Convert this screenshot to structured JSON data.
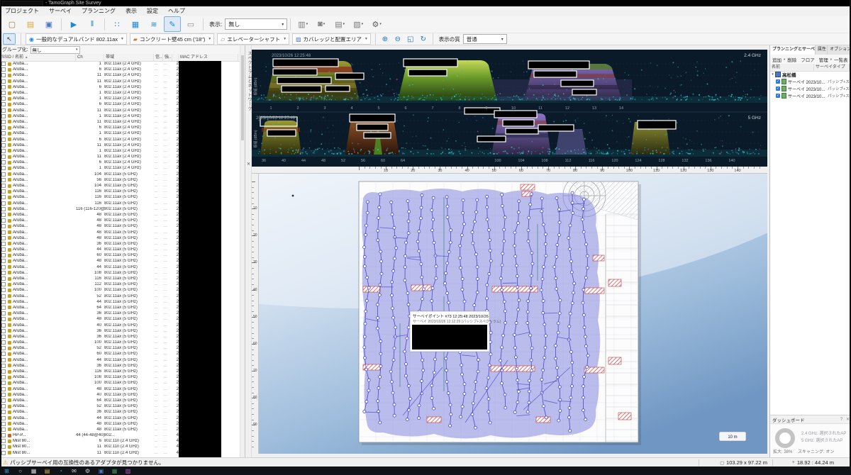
{
  "ui": {
    "dropdown_glyph": "▾",
    "sort_glyph": "▲"
  },
  "titlebar": {
    "title": "- TamoGraph Site Survey"
  },
  "menubar": {
    "items": [
      "プロジェクト",
      "サーベイ",
      "プランニング",
      "表示",
      "設定",
      "ヘルプ"
    ]
  },
  "toolbar1": {
    "buttons": [
      {
        "name": "new-project-icon",
        "glyph": "▢",
        "color": "#9a7a3a"
      },
      {
        "name": "open-project-icon",
        "glyph": "▤",
        "color": "#d8a838"
      },
      {
        "name": "save-project-icon",
        "glyph": "▣",
        "color": "#4a78c0"
      },
      {
        "sep": true
      },
      {
        "name": "start-survey-icon",
        "glyph": "▶",
        "color": "#1e88d0"
      },
      {
        "name": "pause-survey-icon",
        "glyph": "‖",
        "color": "#1e88d0"
      },
      {
        "sep": true
      },
      {
        "name": "survey-point-mode-icon",
        "glyph": "∷",
        "color": "#1e88d0"
      },
      {
        "name": "survey-grid-mode-icon",
        "glyph": "▦",
        "color": "#1e88d0"
      },
      {
        "name": "survey-path-mode-icon",
        "glyph": "≋",
        "color": "#1e88d0"
      },
      {
        "name": "draw-mode-icon",
        "glyph": "✎",
        "color": "#1e88d0",
        "selected": true
      },
      {
        "name": "measure-icon",
        "glyph": "▭",
        "color": "#8a8a8a"
      },
      {
        "sep": true
      }
    ],
    "view_label": "表示:",
    "overlay_value": "無し",
    "buttons2": [
      {
        "name": "link-floors-icon",
        "glyph": "▥",
        "color": "#7a7a7a"
      },
      {
        "name": "snapshot-icon",
        "glyph": "◙",
        "color": "#7a7a7a"
      },
      {
        "name": "report-icon",
        "glyph": "▤",
        "color": "#7a7a7a"
      },
      {
        "name": "export-image-icon",
        "glyph": "▧",
        "color": "#7a7a7a"
      },
      {
        "name": "settings-icon",
        "glyph": "⚙",
        "color": "#5a5a5a"
      }
    ]
  },
  "toolbar2": {
    "cursor_glyph": "↖",
    "items": [
      {
        "name": "ap-model-select",
        "glyph": "◉",
        "glyph_color": "#1e88d0",
        "label": "一般的なデュアルバンド 802.11ax"
      },
      {
        "name": "wall-type-select",
        "glyph": "▰",
        "glyph_color": "#c87830",
        "label": "コンクリート壁45 cm ('18\")"
      },
      {
        "name": "obstruction-select",
        "glyph": "▱",
        "glyph_color": "#8a8a8a",
        "label": "エレベーターシャフト"
      },
      {
        "name": "area-select",
        "glyph": "▨",
        "glyph_color": "#4a78c0",
        "label": "カバレッジと配置エリア"
      }
    ],
    "zoom_icons": [
      {
        "name": "zoom-in-icon",
        "glyph": "⊕"
      },
      {
        "name": "zoom-out-icon",
        "glyph": "⊖"
      },
      {
        "name": "fit-page-icon",
        "glyph": "◱"
      },
      {
        "name": "refresh-icon",
        "glyph": "↻"
      }
    ],
    "quality_label": "表示の質",
    "quality_value": "普通"
  },
  "left_panel": {
    "group_label": "グループ化:",
    "group_value": "無し",
    "columns": [
      "SSID / 名前",
      "Ch",
      "帯域",
      "信...",
      "強...",
      "",
      "MAC アドレス"
    ],
    "default_name": "Aruba...",
    "band_24": "802.11ax (2.4 GHz)",
    "band_5": "802.11ax (5 GHz)",
    "dots": "…",
    "num_default": "2",
    "channels_24": [
      1,
      6,
      11,
      11,
      6,
      1,
      1,
      6,
      11,
      1,
      11,
      6,
      1,
      6,
      11,
      1,
      11,
      6,
      1
    ],
    "channels_5": [
      104,
      56,
      104,
      116,
      116,
      116,
      "116 (116-120@80)",
      48,
      48,
      48,
      48,
      48,
      36,
      44,
      60,
      48,
      44,
      108,
      116,
      112,
      100,
      52,
      44,
      64,
      36,
      48,
      40,
      36,
      36,
      100,
      52,
      60,
      44,
      36,
      116,
      108,
      100,
      48,
      40,
      64,
      52,
      36,
      44,
      48,
      48
    ],
    "special_rows": [
      {
        "name": "HP-P...",
        "ch": "44 (44-48@40)",
        "band": "802...",
        "num": "4",
        "icon": "#d06020"
      },
      {
        "name": "Mist 80...",
        "ch": "6",
        "band": "802.11n (2.4 GHz)",
        "num": "4"
      },
      {
        "name": "Mist 80...",
        "ch": "11",
        "band": "802.11n (2.4 GHz)",
        "num": "4"
      },
      {
        "name": "Mist 80...",
        "ch": "11",
        "band": "802.11n (2.4 GHz)",
        "num": "4"
      }
    ]
  },
  "spectrum": {
    "tab_label": "スペクトラムとネットワーク",
    "close_icon": "✕",
    "band1_label": "2.4 GHz",
    "band2_label": "5 GHz",
    "timestamp1": "2023/10/26 12:25:48",
    "timestamp2": "2023/10/26 12:25:48",
    "ylabel": "振幅 (dBm)",
    "axis_24": [
      "1",
      "2",
      "3",
      "4",
      "5",
      "6",
      "7",
      "8",
      "9",
      "10",
      "11",
      "12",
      "13",
      "14"
    ],
    "axis_5": [
      "36",
      "40",
      "44",
      "48",
      "52",
      "56",
      "60",
      "64",
      "100",
      "104",
      "108",
      "112",
      "116",
      "120",
      "124",
      "128",
      "132",
      "136",
      "140"
    ]
  },
  "map": {
    "ruler_h_values": [
      10,
      20,
      30,
      40,
      50,
      60,
      70,
      80,
      90,
      100,
      110,
      120,
      130,
      140
    ],
    "ruler_v_values": [
      10,
      20,
      30,
      40,
      50,
      60,
      70,
      80,
      90
    ],
    "tooltip_line1": "サーベイポイント #73 12:25:48 2023/10/26",
    "tooltip_line2": "サーベイ 2023/10/26 12:12:29 (パッシブ+スペクトラム)",
    "scale_label": "10 m"
  },
  "right_panel": {
    "tabs": [
      "プランニングとサーベイ",
      "属性",
      "オプション"
    ],
    "toolbar": [
      "追加",
      "削除",
      "フロア",
      "管理",
      "一覧表"
    ],
    "columns": [
      "名前",
      "サーベイタイプ"
    ],
    "expander": "▾",
    "root_name": "高松橋",
    "surveys": [
      {
        "name": "サーベイ 2023/10...",
        "type": "パッシブ+スペク..."
      },
      {
        "name": "サーベイ 2023/10...",
        "type": "パッシブ+スペク..."
      },
      {
        "name": "サーベイ 2023/10...",
        "type": "パッシブ+スペク..."
      }
    ]
  },
  "dashboard": {
    "title": "ダッシュボード",
    "help_glyph": "?",
    "close_glyph": "✕",
    "line1": "2.4 GHz: 選択されたAP",
    "line2": "5 GHz: 選択されたAP",
    "zoom_text": "拡大: 38%",
    "scan_text": "スキャニング: オン"
  },
  "statusbar": {
    "warning_glyph": "⚠",
    "warning_text": "パッシブサーベイ用の互換性のあるアダプタが見つかりません。",
    "dim_text": "103.29 x 97.22 m",
    "pos_text": "18.92 : 44.24 m"
  },
  "taskbar": {
    "icons": [
      {
        "name": "start-button",
        "glyph": "⊞",
        "color": "#3a9bdc"
      },
      {
        "name": "search-icon",
        "glyph": "○",
        "color": "#cfcfcf"
      },
      {
        "name": "task-view-icon",
        "glyph": "▦",
        "color": "#cfcfcf"
      },
      {
        "name": "explorer-icon",
        "glyph": "▤",
        "color": "#d8b24a"
      },
      {
        "name": "browser-icon",
        "glyph": "◔",
        "color": "#4aa3dc"
      },
      {
        "name": "mail-icon",
        "glyph": "✉",
        "color": "#cfcfcf"
      },
      {
        "name": "settings-icon",
        "glyph": "⚙",
        "color": "#cfcfcf"
      },
      {
        "name": "document-icon",
        "glyph": "▣",
        "color": "#4a78c0"
      },
      {
        "name": "spreadsheet-icon",
        "glyph": "▦",
        "color": "#3f8f4f"
      },
      {
        "name": "app-icon",
        "glyph": "▨",
        "color": "#b05ab0"
      }
    ]
  }
}
